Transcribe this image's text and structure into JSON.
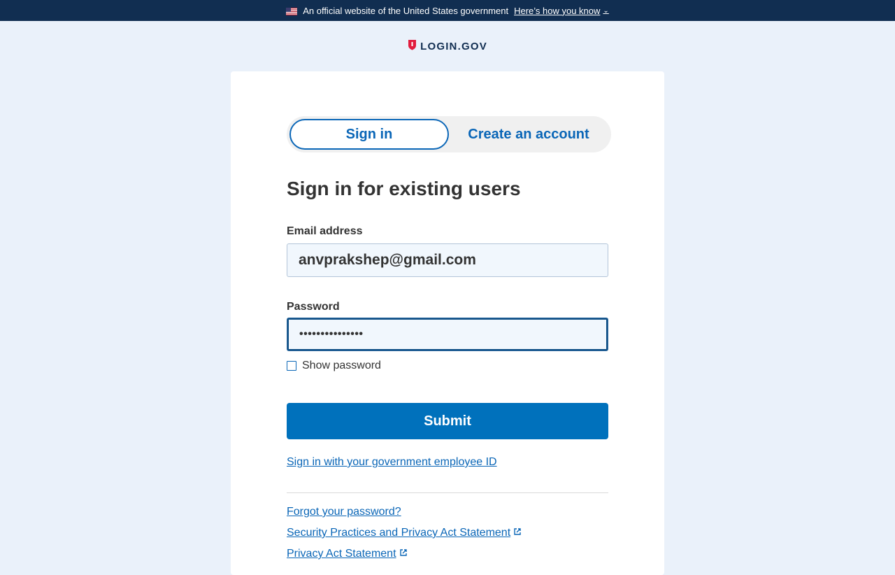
{
  "banner": {
    "text": "An official website of the United States government",
    "link": "Here’s how you know",
    "flag_icon": "us-flag-icon",
    "chevron_icon": "chevron-down-icon"
  },
  "brand": {
    "name": "LOGIN.GOV",
    "logo_icon": "shield-icon",
    "color": "#112e51"
  },
  "tabs": {
    "sign_in": "Sign in",
    "create_account": "Create an account"
  },
  "heading": "Sign in for existing users",
  "form": {
    "email_label": "Email address",
    "email_value": "anvprakshep@gmail.com",
    "password_label": "Password",
    "password_value": "•••••••••••••••",
    "show_password_label": "Show password",
    "show_password_checked": false,
    "submit_label": "Submit"
  },
  "links": {
    "piv": "Sign in with your government employee ID",
    "forgot": "Forgot your password?",
    "security": "Security Practices and Privacy Act Statement",
    "privacy": "Privacy Act Statement",
    "external_icon": "external-link-icon"
  },
  "colors": {
    "accent": "#0071bc",
    "link": "#0a66b7",
    "banner": "#112e51",
    "page_bg": "#eaf1fa"
  }
}
